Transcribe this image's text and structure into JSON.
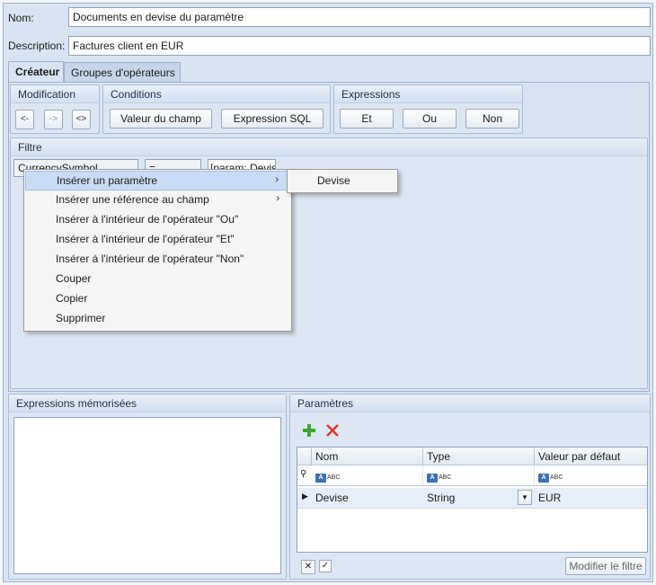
{
  "form": {
    "name_label": "Nom:",
    "name_value": "Documents en devise du paramètre",
    "description_label": "Description:",
    "description_value": "Factures client en EUR"
  },
  "tabs": [
    {
      "label": "Créateur",
      "active": true
    },
    {
      "label": "Groupes d'opérateurs",
      "active": false
    }
  ],
  "modification": {
    "title": "Modification",
    "buttons": [
      "<-",
      "->",
      "<>"
    ]
  },
  "conditions": {
    "title": "Conditions",
    "buttons": [
      "Valeur du champ",
      "Expression SQL"
    ]
  },
  "expressions": {
    "title": "Expressions",
    "buttons": [
      "Et",
      "Ou",
      "Non"
    ]
  },
  "filter": {
    "title": "Filtre",
    "field_text": "CurrencySymbol",
    "operator_text": "=",
    "value_text": "[param: Devise"
  },
  "context_menu": {
    "items": [
      {
        "label": "Insérer un paramètre",
        "submenu": true,
        "highlighted": true
      },
      {
        "label": "Insérer une référence au champ",
        "submenu": true,
        "highlighted": false
      },
      {
        "label": "Insérer à l'intérieur de l'opérateur \"Ou\"",
        "submenu": false,
        "highlighted": false
      },
      {
        "label": "Insérer à l'intérieur de l'opérateur \"Et\"",
        "submenu": false,
        "highlighted": false
      },
      {
        "label": "Insérer à l'intérieur de l'opérateur \"Non\"",
        "submenu": false,
        "highlighted": false
      },
      {
        "label": "Couper",
        "submenu": false,
        "highlighted": false
      },
      {
        "label": "Copier",
        "submenu": false,
        "highlighted": false
      },
      {
        "label": "Supprimer",
        "submenu": false,
        "highlighted": false
      }
    ],
    "submenu_items": [
      "Devise"
    ]
  },
  "saved_expressions": {
    "title": "Expressions mémorisées"
  },
  "parameters": {
    "title": "Paramètres",
    "columns": [
      "Nom",
      "Type",
      "Valeur par défaut"
    ],
    "filter_row_glyph": "ABC",
    "rows": [
      {
        "name": "Devise",
        "type": "String",
        "default": "EUR"
      }
    ],
    "modify_filter_label": "Modifier le filtre"
  },
  "colors": {
    "window_bg": "#d9e4f2",
    "menu_highlight": "#c8dcf5",
    "add_icon": "#3da52f",
    "delete_icon": "#e0332a"
  }
}
